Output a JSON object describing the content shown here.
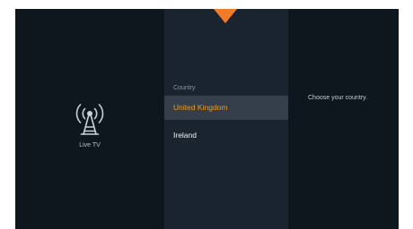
{
  "source_panel": {
    "icon": "broadcast-antenna-icon",
    "label": "Live TV"
  },
  "country_list": {
    "header": "Country",
    "items": [
      {
        "label": "United Kingdom",
        "selected": true
      },
      {
        "label": "Ireland",
        "selected": false
      }
    ]
  },
  "info_panel": {
    "hint": "Choose your country."
  },
  "indicator": {
    "icon": "down-arrow-indicator-icon",
    "color": "#f07c2a"
  },
  "colors": {
    "background": "#0f171e",
    "list_background": "#1a242f",
    "selection_background": "#343f4b",
    "selection_text": "#f39c1b"
  }
}
